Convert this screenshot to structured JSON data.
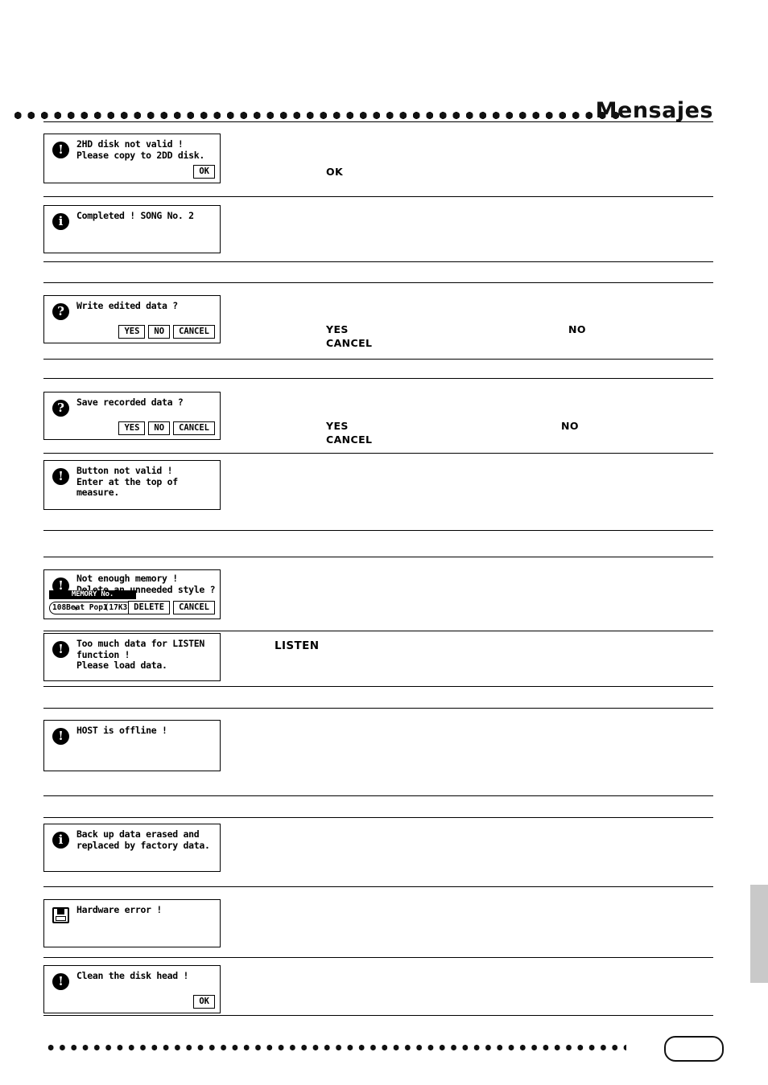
{
  "header": {
    "title": "Mensajes"
  },
  "messages": [
    {
      "id": "msg-2hd-disk-not-valid",
      "icon": "exclamation-icon",
      "text": "2HD disk not valid !\nPlease copy to 2DD disk.",
      "buttons": [
        "OK"
      ]
    },
    {
      "id": "msg-completed-song",
      "icon": "information-icon",
      "text": "Completed ! SONG No. 2",
      "buttons": []
    },
    {
      "id": "msg-write-edited-data",
      "icon": "question-icon",
      "text": "Write edited data ?",
      "buttons": [
        "YES",
        "NO",
        "CANCEL"
      ]
    },
    {
      "id": "msg-save-recorded-data",
      "icon": "question-icon",
      "text": "Save recorded data ?",
      "buttons": [
        "YES",
        "NO",
        "CANCEL"
      ]
    },
    {
      "id": "msg-button-not-valid",
      "icon": "exclamation-icon",
      "text": "Button not valid !\nEnter at the top of\nmeasure.",
      "buttons": []
    },
    {
      "id": "msg-not-enough-memory",
      "icon": "exclamation-icon",
      "text": "Not enough memory !\nDelete an unneeded style ?",
      "buttons": [
        "DELETE",
        "CANCEL"
      ],
      "memory_widget": {
        "label": "MEMORY No.",
        "value": "108Beat Pop1",
        "size": "(17K3)"
      }
    },
    {
      "id": "msg-too-much-data-listen",
      "icon": "exclamation-icon",
      "text": "Too much data for LISTEN\nfunction !\nPlease load data.",
      "buttons": []
    },
    {
      "id": "msg-host-offline",
      "icon": "exclamation-icon",
      "text": "HOST is offline !",
      "buttons": []
    },
    {
      "id": "msg-backup-data-erased",
      "icon": "information-icon",
      "text": "Back up data erased and\nreplaced by factory data.",
      "buttons": []
    },
    {
      "id": "msg-hardware-error",
      "icon": "disk-icon",
      "text": "Hardware error !",
      "buttons": []
    },
    {
      "id": "msg-clean-disk-head",
      "icon": "exclamation-icon",
      "text": "Clean the disk head !",
      "buttons": [
        "OK"
      ]
    }
  ],
  "annotations": {
    "ok_1": "OK",
    "yes_1": "YES\nCANCEL",
    "no_1": "NO",
    "yes_2": "YES\nCANCEL",
    "no_2": "NO",
    "listen": "LISTEN"
  }
}
